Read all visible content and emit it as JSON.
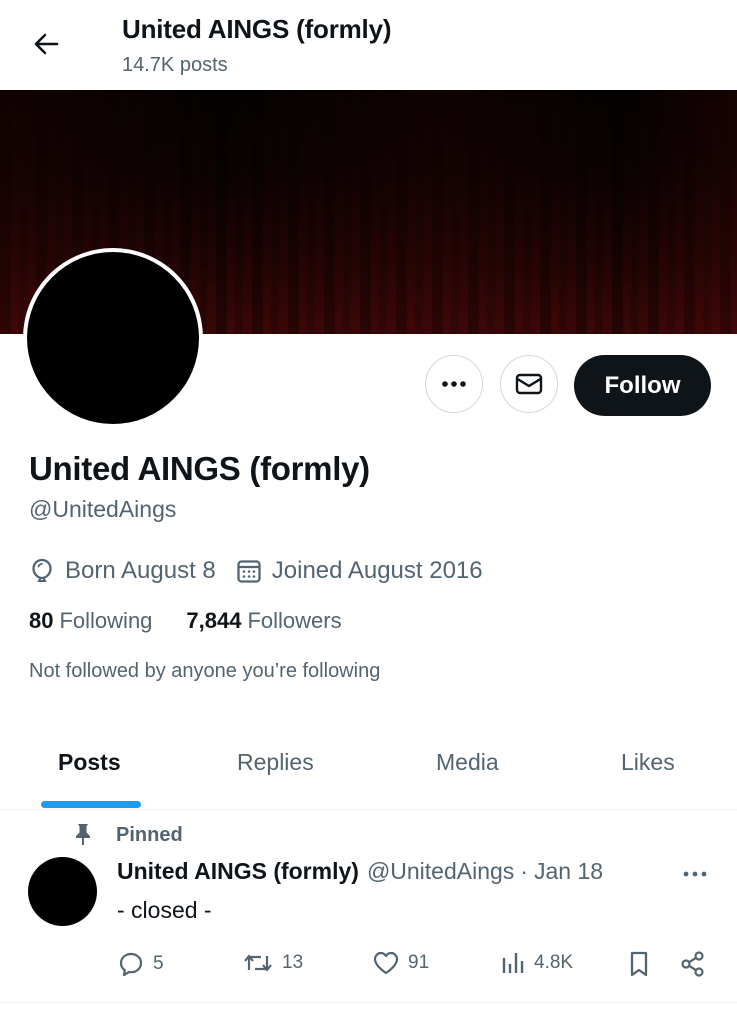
{
  "header": {
    "title": "United AINGS (formly)",
    "posts_count": "14.7K posts",
    "back_icon": "arrow-left-icon"
  },
  "profile": {
    "display_name": "United AINGS (formly)",
    "handle": "@UnitedAings",
    "born": "Born August 8",
    "joined": "Joined August 2016",
    "following_count": "80",
    "following_label": "Following",
    "followers_count": "7,844",
    "followers_label": "Followers",
    "not_followed_text": "Not followed by anyone you’re following"
  },
  "actions": {
    "more_icon": "more-horizontal-icon",
    "message_icon": "envelope-icon",
    "follow_label": "Follow"
  },
  "tabs": [
    {
      "label": "Posts",
      "active": true
    },
    {
      "label": "Replies",
      "active": false
    },
    {
      "label": "Media",
      "active": false
    },
    {
      "label": "Likes",
      "active": false
    }
  ],
  "pinned_tweet": {
    "pinned_label": "Pinned",
    "author_name": "United AINGS (formly)",
    "author_handle": "@UnitedAings",
    "separator": "·",
    "date": "Jan 18",
    "text": "- closed -",
    "reply_count": "5",
    "retweet_count": "13",
    "like_count": "91",
    "view_count": "4.8K"
  },
  "colors": {
    "accent": "#1d9bf0",
    "text_primary": "#0f1419",
    "text_secondary": "#536471",
    "follow_button_bg": "#0f1419",
    "border": "#cfd9de",
    "banner_dark": "#050101",
    "banner_red": "#3a0807"
  }
}
